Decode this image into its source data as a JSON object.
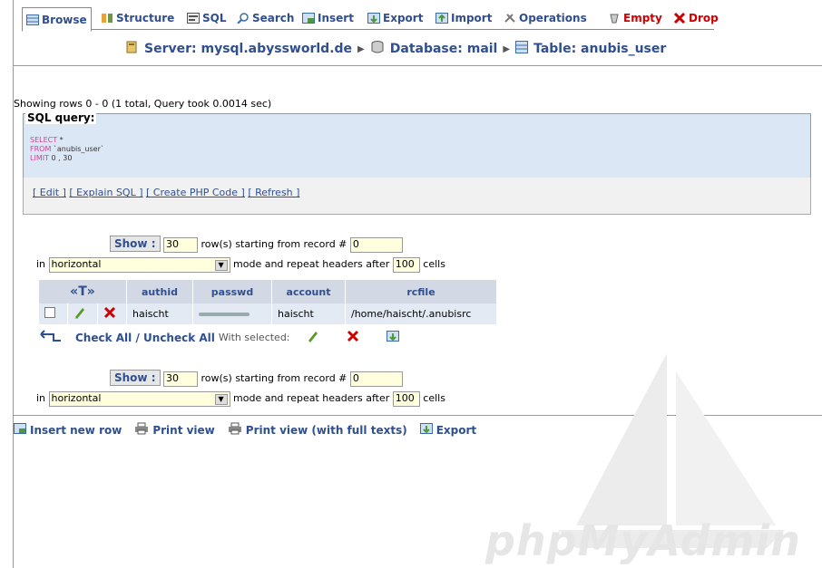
{
  "tabs": [
    {
      "label": "Browse"
    },
    {
      "label": "Structure"
    },
    {
      "label": "SQL"
    },
    {
      "label": "Search"
    },
    {
      "label": "Insert"
    },
    {
      "label": "Export"
    },
    {
      "label": "Import"
    },
    {
      "label": "Operations"
    },
    {
      "label": "Empty"
    },
    {
      "label": "Drop"
    }
  ],
  "breadcrumb": {
    "server": "Server: mysql.abyssworld.de",
    "database": "Database: mail",
    "table": "Table: anubis_user"
  },
  "info": "Showing rows 0 - 0 (1 total, Query took 0.0014 sec)",
  "sql": {
    "legend": "SQL query:",
    "line1_kw": "SELECT",
    "line1_rest": " *",
    "line2_kw": "FROM",
    "line2_rest": " `anubis_user`",
    "line3_kw": "LIMIT",
    "line3_rest": " 0 , 30",
    "links": [
      "[ Edit ]",
      "[ Explain SQL ]",
      "[ Create PHP Code ]",
      "[ Refresh ]"
    ]
  },
  "nav_top": {
    "show_label": "Show :",
    "rows": "30",
    "rows_text": "row(s) starting from record #",
    "start": "0",
    "in_label": "in",
    "mode": "horizontal",
    "mode_text": "mode and repeat headers after",
    "repeat": "100",
    "cells": "cells"
  },
  "nav_bottom": {
    "show_label": "Show :",
    "rows": "30",
    "rows_text": "row(s) starting from record #",
    "start": "0",
    "in_label": "in",
    "mode": "horizontal",
    "mode_text": "mode and repeat headers after",
    "repeat": "100",
    "cells": "cells"
  },
  "table": {
    "columns": [
      "authid",
      "passwd",
      "account",
      "rcfile"
    ],
    "sort_label": "«T»",
    "rows": [
      {
        "authid": "haischt",
        "passwd": "",
        "account": "haischt",
        "rcfile": "/home/haischt/.anubisrc"
      }
    ]
  },
  "check": {
    "check_all": "Check All",
    "sep": " / ",
    "uncheck_all": "Uncheck All",
    "with_selected": "With selected:"
  },
  "bottom_links": [
    "Insert new row",
    "Print view",
    "Print view (with full texts)",
    "Export"
  ],
  "watermark": "phpMyAdmin",
  "colors": {
    "link": "#2f4f8f",
    "sql_bg": "#dce7f5",
    "header_bg": "#d2d9e4",
    "row_bg": "#e4eaf3",
    "danger": "#cc0000"
  }
}
